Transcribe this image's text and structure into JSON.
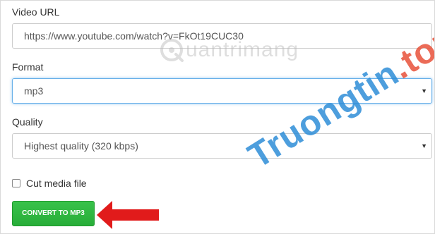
{
  "video_url": {
    "label": "Video URL",
    "value": "https://www.youtube.com/watch?v=FkOt19CUC30"
  },
  "format": {
    "label": "Format",
    "selected": "mp3",
    "caret": "▼"
  },
  "quality": {
    "label": "Quality",
    "selected": "Highest quality (320 kbps)",
    "caret": "▼"
  },
  "cut_media": {
    "label": "Cut media file",
    "checked": false
  },
  "convert_button": {
    "label": "CONVERT TO MP3",
    "color": "#2fb741"
  },
  "arrow_color": "#e11b1b",
  "watermarks": {
    "top_text": "uantrimang",
    "diagonal_main": "Truongtin",
    "diagonal_dot": ".",
    "diagonal_tld": "top",
    "colors": {
      "blue": "#2e8ed8",
      "red": "#e8523a"
    }
  }
}
